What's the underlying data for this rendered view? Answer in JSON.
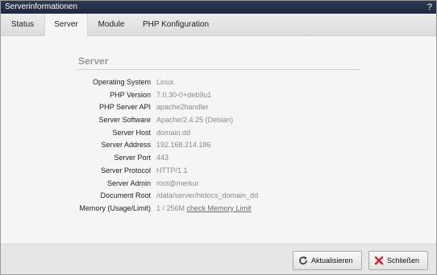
{
  "window": {
    "title": "Serverinformationen",
    "help_label": "?"
  },
  "tabs": [
    {
      "label": "Status",
      "active": false
    },
    {
      "label": "Server",
      "active": true
    },
    {
      "label": "Module",
      "active": false
    },
    {
      "label": "PHP Konfiguration",
      "active": false
    }
  ],
  "section": {
    "title": "Server"
  },
  "rows": [
    {
      "label": "Operating System",
      "value": "Linux"
    },
    {
      "label": "PHP Version",
      "value": "7.0.30-0+deb9u1"
    },
    {
      "label": "PHP Server API",
      "value": "apache2handler"
    },
    {
      "label": "Server Software",
      "value": "Apache/2.4.25 (Debian)"
    },
    {
      "label": "Server Host",
      "value": "domain.dd"
    },
    {
      "label": "Server Address",
      "value": "192.168.214.186"
    },
    {
      "label": "Server Port",
      "value": "443"
    },
    {
      "label": "Server Protocol",
      "value": "HTTP/1.1"
    },
    {
      "label": "Server Admin",
      "value": "root@merkur"
    },
    {
      "label": "Document Root",
      "value": "/data/server/htdocs_domain_dd"
    },
    {
      "label": "Memory (Usage/Limit)",
      "value": "1 / 256M",
      "link": "check Memory Limit"
    }
  ],
  "footer": {
    "refresh_label": "Aktualisieren",
    "close_label": "Schließen"
  },
  "colors": {
    "titlebar": "#1f2940",
    "close_icon": "#d8232a",
    "refresh_icon": "#444444"
  },
  "icons": {
    "refresh": "refresh-icon",
    "close": "close-icon"
  }
}
